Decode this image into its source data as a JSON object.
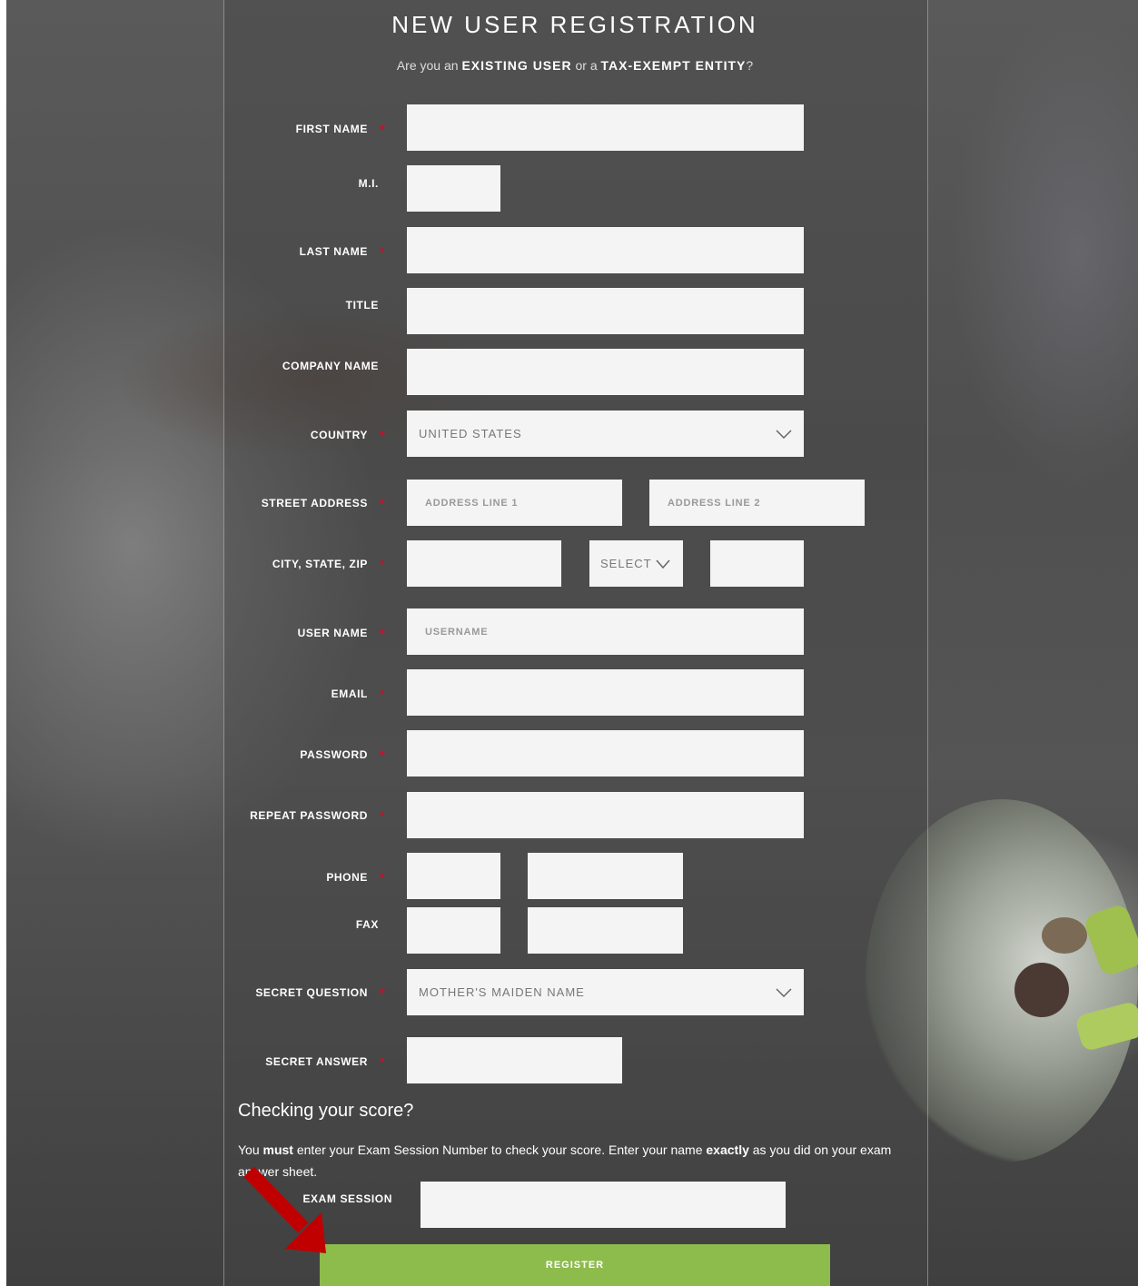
{
  "header": {
    "title": "NEW USER REGISTRATION",
    "subtitle_prefix": "Are you an",
    "existing_user": "EXISTING USER",
    "subtitle_mid": "or a",
    "tax_exempt": "TAX-EXEMPT ENTITY",
    "subtitle_suffix": "?"
  },
  "form": {
    "required_mark": "*",
    "first_name_label": "FIRST NAME",
    "mi_label": "M.I.",
    "last_name_label": "LAST NAME",
    "title_label": "TITLE",
    "company_label": "COMPANY NAME",
    "country_label": "COUNTRY",
    "country_value": "UNITED STATES",
    "street_label": "STREET ADDRESS",
    "address1_placeholder": "ADDRESS LINE 1",
    "address2_placeholder": "ADDRESS LINE 2",
    "city_state_zip_label": "CITY, STATE, ZIP",
    "state_value": "SELECT",
    "username_label": "USER NAME",
    "username_placeholder": "USERNAME",
    "email_label": "EMAIL",
    "password_label": "PASSWORD",
    "repeat_password_label": "REPEAT PASSWORD",
    "phone_label": "PHONE",
    "fax_label": "FAX",
    "secret_question_label": "SECRET QUESTION",
    "secret_question_value": "MOTHER'S MAIDEN NAME",
    "secret_answer_label": "SECRET ANSWER"
  },
  "score": {
    "title": "Checking your score?",
    "p1": "You ",
    "must": "must",
    "p2": " enter your Exam Session Number to check your score. Enter your name ",
    "exactly": "exactly",
    "p3": " as you did on your exam answer sheet.",
    "exam_session_label": "EXAM SESSION"
  },
  "register_label": "REGISTER",
  "colors": {
    "accent": "#8dbb4c",
    "required": "#c8102e",
    "arrow": "#c00000"
  }
}
